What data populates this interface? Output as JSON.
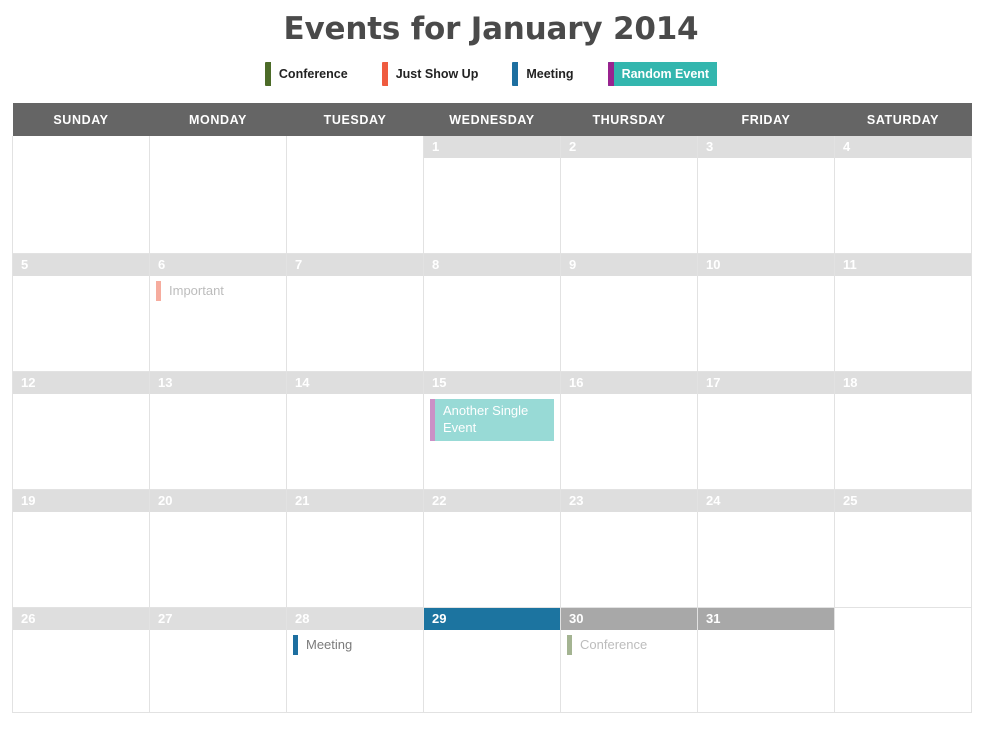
{
  "header": {
    "title": "Events for January 2014"
  },
  "legend": {
    "items": [
      {
        "label": "Conference",
        "bar_color": "#4c6b28",
        "fill_color": "transparent",
        "style": "bar"
      },
      {
        "label": "Just Show Up",
        "bar_color": "#ef5b3f",
        "fill_color": "transparent",
        "style": "bar"
      },
      {
        "label": "Meeting",
        "bar_color": "#1d6fa0",
        "fill_color": "transparent",
        "style": "bar"
      },
      {
        "label": "Random Event",
        "bar_color": "#99238f",
        "fill_color": "#33b6ae",
        "style": "filled"
      }
    ]
  },
  "calendar": {
    "weekday_headers": [
      "SUNDAY",
      "MONDAY",
      "TUESDAY",
      "WEDNESDAY",
      "THURSDAY",
      "FRIDAY",
      "SATURDAY"
    ],
    "weeks": [
      [
        {
          "day": "",
          "state": "empty",
          "events": []
        },
        {
          "day": "",
          "state": "empty",
          "events": []
        },
        {
          "day": "",
          "state": "empty",
          "events": []
        },
        {
          "day": "1",
          "state": "normal",
          "events": []
        },
        {
          "day": "2",
          "state": "normal",
          "events": []
        },
        {
          "day": "3",
          "state": "normal",
          "events": []
        },
        {
          "day": "4",
          "state": "normal",
          "events": []
        }
      ],
      [
        {
          "day": "5",
          "state": "normal",
          "events": []
        },
        {
          "day": "6",
          "state": "normal",
          "events": [
            {
              "title": "Important",
              "bar_color": "#ef5b3f",
              "fill_color": "transparent",
              "style": "bar",
              "faded": true
            }
          ]
        },
        {
          "day": "7",
          "state": "normal",
          "events": []
        },
        {
          "day": "8",
          "state": "normal",
          "events": []
        },
        {
          "day": "9",
          "state": "normal",
          "events": []
        },
        {
          "day": "10",
          "state": "normal",
          "events": []
        },
        {
          "day": "11",
          "state": "normal",
          "events": []
        }
      ],
      [
        {
          "day": "12",
          "state": "normal",
          "events": []
        },
        {
          "day": "13",
          "state": "normal",
          "events": []
        },
        {
          "day": "14",
          "state": "normal",
          "events": []
        },
        {
          "day": "15",
          "state": "normal",
          "events": [
            {
              "title": "Another Single Event",
              "bar_color": "#99238f",
              "fill_color": "#33b6ae",
              "style": "filled",
              "faded": true
            }
          ]
        },
        {
          "day": "16",
          "state": "normal",
          "events": []
        },
        {
          "day": "17",
          "state": "normal",
          "events": []
        },
        {
          "day": "18",
          "state": "normal",
          "events": []
        }
      ],
      [
        {
          "day": "19",
          "state": "normal",
          "events": []
        },
        {
          "day": "20",
          "state": "normal",
          "events": []
        },
        {
          "day": "21",
          "state": "normal",
          "events": []
        },
        {
          "day": "22",
          "state": "normal",
          "events": []
        },
        {
          "day": "23",
          "state": "normal",
          "events": []
        },
        {
          "day": "24",
          "state": "normal",
          "events": []
        },
        {
          "day": "25",
          "state": "normal",
          "events": []
        }
      ],
      [
        {
          "day": "26",
          "state": "normal",
          "events": []
        },
        {
          "day": "27",
          "state": "normal",
          "events": []
        },
        {
          "day": "28",
          "state": "normal",
          "events": [
            {
              "title": "Meeting",
              "bar_color": "#1d6fa0",
              "fill_color": "transparent",
              "style": "bar",
              "faded": false
            }
          ]
        },
        {
          "day": "29",
          "state": "today",
          "events": []
        },
        {
          "day": "30",
          "state": "hovered",
          "events": [
            {
              "title": "Conference",
              "bar_color": "#4c6b28",
              "fill_color": "transparent",
              "style": "bar",
              "faded": true
            }
          ]
        },
        {
          "day": "31",
          "state": "hovered",
          "events": []
        },
        {
          "day": "",
          "state": "empty",
          "events": []
        }
      ]
    ]
  }
}
